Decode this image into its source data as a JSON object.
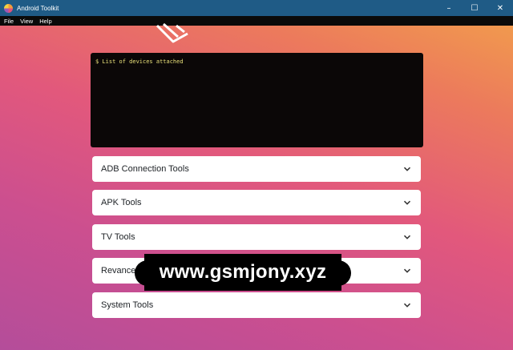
{
  "window": {
    "title": "Android Toolkit",
    "controls": {
      "minimize": "–",
      "maximize": "☐",
      "close": "✕"
    }
  },
  "menu": {
    "items": [
      {
        "label": "File"
      },
      {
        "label": "View"
      },
      {
        "label": "Help"
      }
    ]
  },
  "terminal": {
    "output": "$ List of devices attached",
    "text_color": "#e9e07a",
    "background": "#0b0707"
  },
  "accordion": {
    "items": [
      {
        "label": "ADB Connection Tools"
      },
      {
        "label": "APK Tools"
      },
      {
        "label": "TV Tools"
      },
      {
        "label": "Revanced"
      },
      {
        "label": "System Tools"
      }
    ]
  },
  "watermark": {
    "text": "www.gsmjony.xyz"
  },
  "icons": {
    "app": "android-toolkit-app-icon",
    "chevron": "chevron-down-icon",
    "logo": "toolkit-logo-icon"
  },
  "colors": {
    "titlebar": "#1f5b86",
    "menubar": "#0a0a0a",
    "gradient_top": "#f2a24a",
    "gradient_bottom": "#b44d9a"
  }
}
